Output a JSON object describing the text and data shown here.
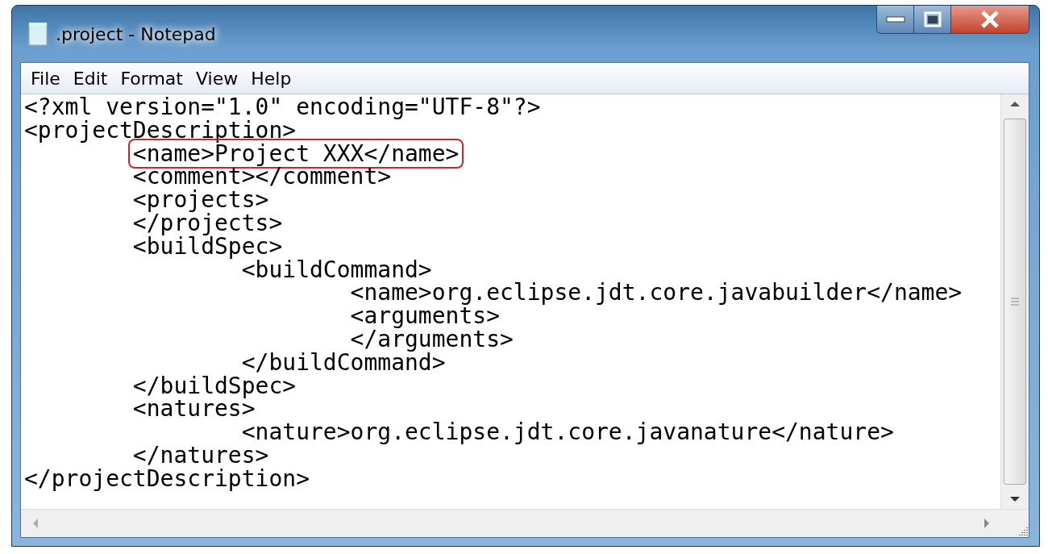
{
  "window": {
    "title": ".project - Notepad"
  },
  "menu": [
    {
      "label": "File"
    },
    {
      "label": "Edit"
    },
    {
      "label": "Format"
    },
    {
      "label": "View"
    },
    {
      "label": "Help"
    }
  ],
  "editor": {
    "lines": [
      {
        "text": "<?xml version=\"1.0\" encoding=\"UTF-8\"?>",
        "highlighted": false
      },
      {
        "text": "<projectDescription>",
        "highlighted": false
      },
      {
        "text": "\t<name>Project XXX</name>",
        "highlighted": true
      },
      {
        "text": "\t<comment></comment>",
        "highlighted": false
      },
      {
        "text": "\t<projects>",
        "highlighted": false
      },
      {
        "text": "\t</projects>",
        "highlighted": false
      },
      {
        "text": "\t<buildSpec>",
        "highlighted": false
      },
      {
        "text": "\t\t<buildCommand>",
        "highlighted": false
      },
      {
        "text": "\t\t\t<name>org.eclipse.jdt.core.javabuilder</name>",
        "highlighted": false
      },
      {
        "text": "\t\t\t<arguments>",
        "highlighted": false
      },
      {
        "text": "\t\t\t</arguments>",
        "highlighted": false
      },
      {
        "text": "\t\t</buildCommand>",
        "highlighted": false
      },
      {
        "text": "\t</buildSpec>",
        "highlighted": false
      },
      {
        "text": "\t<natures>",
        "highlighted": false
      },
      {
        "text": "\t\t<nature>org.eclipse.jdt.core.javanature</nature>",
        "highlighted": false
      },
      {
        "text": "\t</natures>",
        "highlighted": false
      },
      {
        "text": "</projectDescription>",
        "highlighted": false
      }
    ]
  }
}
